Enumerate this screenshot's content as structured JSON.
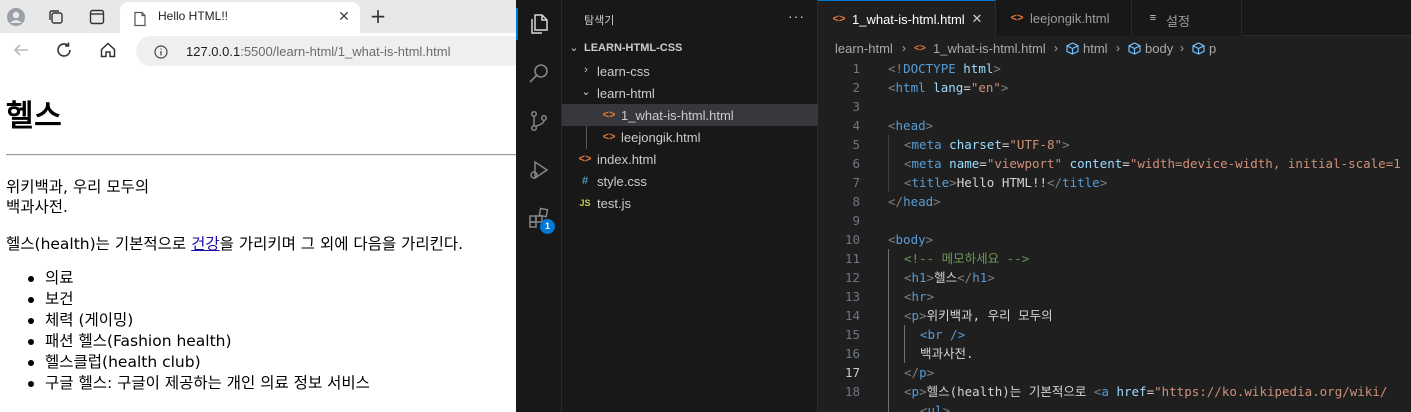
{
  "browser": {
    "tab_title": "Hello HTML!!",
    "close_glyph": "✕",
    "new_tab_glyph": "+",
    "url_host": "127.0.0.1",
    "url_path": ":5500/learn-html/1_what-is-html.html"
  },
  "webpage": {
    "heading": "헬스",
    "para1_line1": "위키백과, 우리 모두의",
    "para1_line2": "백과사전.",
    "para2_before": "헬스(health)는 기본적으로 ",
    "para2_link": "건강",
    "para2_after": "을 가리키며 그 외에 다음을 가리킨다.",
    "list_items": [
      "의료",
      "보건",
      "체력 (게이밍)",
      "패션 헬스(Fashion health)",
      "헬스클럽(health club)",
      "구글 헬스: 구글이 제공하는 개인 의료 정보 서비스"
    ]
  },
  "vscode": {
    "activity_badge": "1",
    "sidebar_title": "탐색기",
    "sidebar_more": "···",
    "project_name": "LEARN-HTML-CSS",
    "tree": {
      "learn_css": "learn-css",
      "learn_html": "learn-html",
      "file_1": "1_what-is-html.html",
      "file_2": "leejongik.html",
      "index": "index.html",
      "style": "style.css",
      "test": "test.js",
      "js_icon": "JS",
      "css_icon": "#",
      "html_icon": "<>"
    },
    "tabs": {
      "tab1": "1_what-is-html.html",
      "tab2": "leejongik.html",
      "tab3": "설정",
      "close_glyph": "✕"
    },
    "breadcrumbs": {
      "folder": "learn-html",
      "file": "1_what-is-html.html",
      "html": "html",
      "body": "body",
      "p": "p"
    },
    "code_lines": [
      {
        "n": "1"
      },
      {
        "n": "2"
      },
      {
        "n": "3"
      },
      {
        "n": "4"
      },
      {
        "n": "5"
      },
      {
        "n": "6"
      },
      {
        "n": "7"
      },
      {
        "n": "8"
      },
      {
        "n": "9"
      },
      {
        "n": "10"
      },
      {
        "n": "11"
      },
      {
        "n": "12"
      },
      {
        "n": "13"
      },
      {
        "n": "14"
      },
      {
        "n": "15"
      },
      {
        "n": "16"
      },
      {
        "n": "17"
      },
      {
        "n": "18"
      }
    ],
    "current_line": "17",
    "code": {
      "l1_a": "<!",
      "l1_b": "DOCTYPE",
      "l1_c": " html",
      "l1_d": ">",
      "lang_val": "\"en\"",
      "charset_val": "\"UTF-8\"",
      "viewport_val": "\"viewport\"",
      "content_val": "\"width=device-width, initial-scale=1",
      "title_text": "Hello HTML!!",
      "comment": "<!-- 메모하세요 -->",
      "h1_text": "헬스",
      "p1_text": "위키백과, 우리 모두의",
      "br_tag": "<br />",
      "p1_text2": "백과사전.",
      "p2_text": "헬스(health)는 기본적으로 ",
      "href_val": "\"https://ko.wikipedia.org/wiki/"
    }
  }
}
